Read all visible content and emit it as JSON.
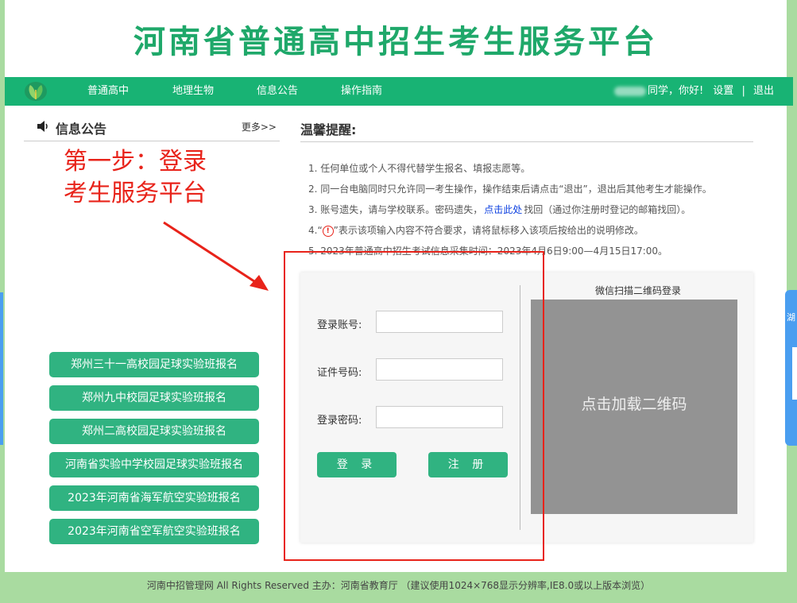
{
  "header": {
    "site_title": "河南省普通高中招生考生服务平台"
  },
  "nav": {
    "items": [
      "普通高中",
      "地理生物",
      "信息公告",
      "操作指南"
    ],
    "greeting": "同学，你好!",
    "settings": "设置",
    "separator": "|",
    "logout": "退出"
  },
  "notice": {
    "title": "信息公告",
    "more": "更多>>"
  },
  "annotation": {
    "line1": "第一步：登录",
    "line2": "考生服务平台"
  },
  "special_links": [
    "郑州三十一高校园足球实验班报名",
    "郑州九中校园足球实验班报名",
    "郑州二高校园足球实验班报名",
    "河南省实验中学校园足球实验班报名",
    "2023年河南省海军航空实验班报名",
    "2023年河南省空军航空实验班报名"
  ],
  "tips": {
    "title": "温馨提醒:",
    "t1": "1. 任何单位或个人不得代替学生报名、填报志愿等。",
    "t2": "2. 同一台电脑同时只允许同一考生操作，操作结束后请点击“退出”，退出后其他考生才能操作。",
    "t3_pre": "3. 账号遗失，请与学校联系。密码遗失，",
    "t3_link": "点击此处",
    "t3_post": "找回（通过你注册时登记的邮箱找回）。",
    "t4_pre": "4.“",
    "t4_icon": "!",
    "t4_post": "”表示该项输入内容不符合要求，请将鼠标移入该项后按给出的说明修改。",
    "t5": "5. 2023年普通高中招生考试信息采集时间：2023年4月6日9:00—4月15日17:00。"
  },
  "login": {
    "account_label": "登录账号:",
    "account_value": "",
    "id_label": "证件号码:",
    "id_value": "",
    "password_label": "登录密码:",
    "password_value": "",
    "login_button": "登 录",
    "register_button": "注 册"
  },
  "wechat": {
    "label": "微信扫描二维码登录",
    "qr_text": "点击加载二维码"
  },
  "side": {
    "right_tab_char": "湖"
  },
  "footer": {
    "text": "河南中招管理网 All Rights Reserved 主办：河南省教育厅 （建议使用1024×768显示分辨率,IE8.0或以上版本浏览）"
  },
  "colors": {
    "brand_green": "#18b374",
    "button_green": "#30b381",
    "title_green": "#1fa86a",
    "annotation_red": "#e8231a",
    "link_blue": "#0a3ee0",
    "qr_gray": "#939393"
  }
}
